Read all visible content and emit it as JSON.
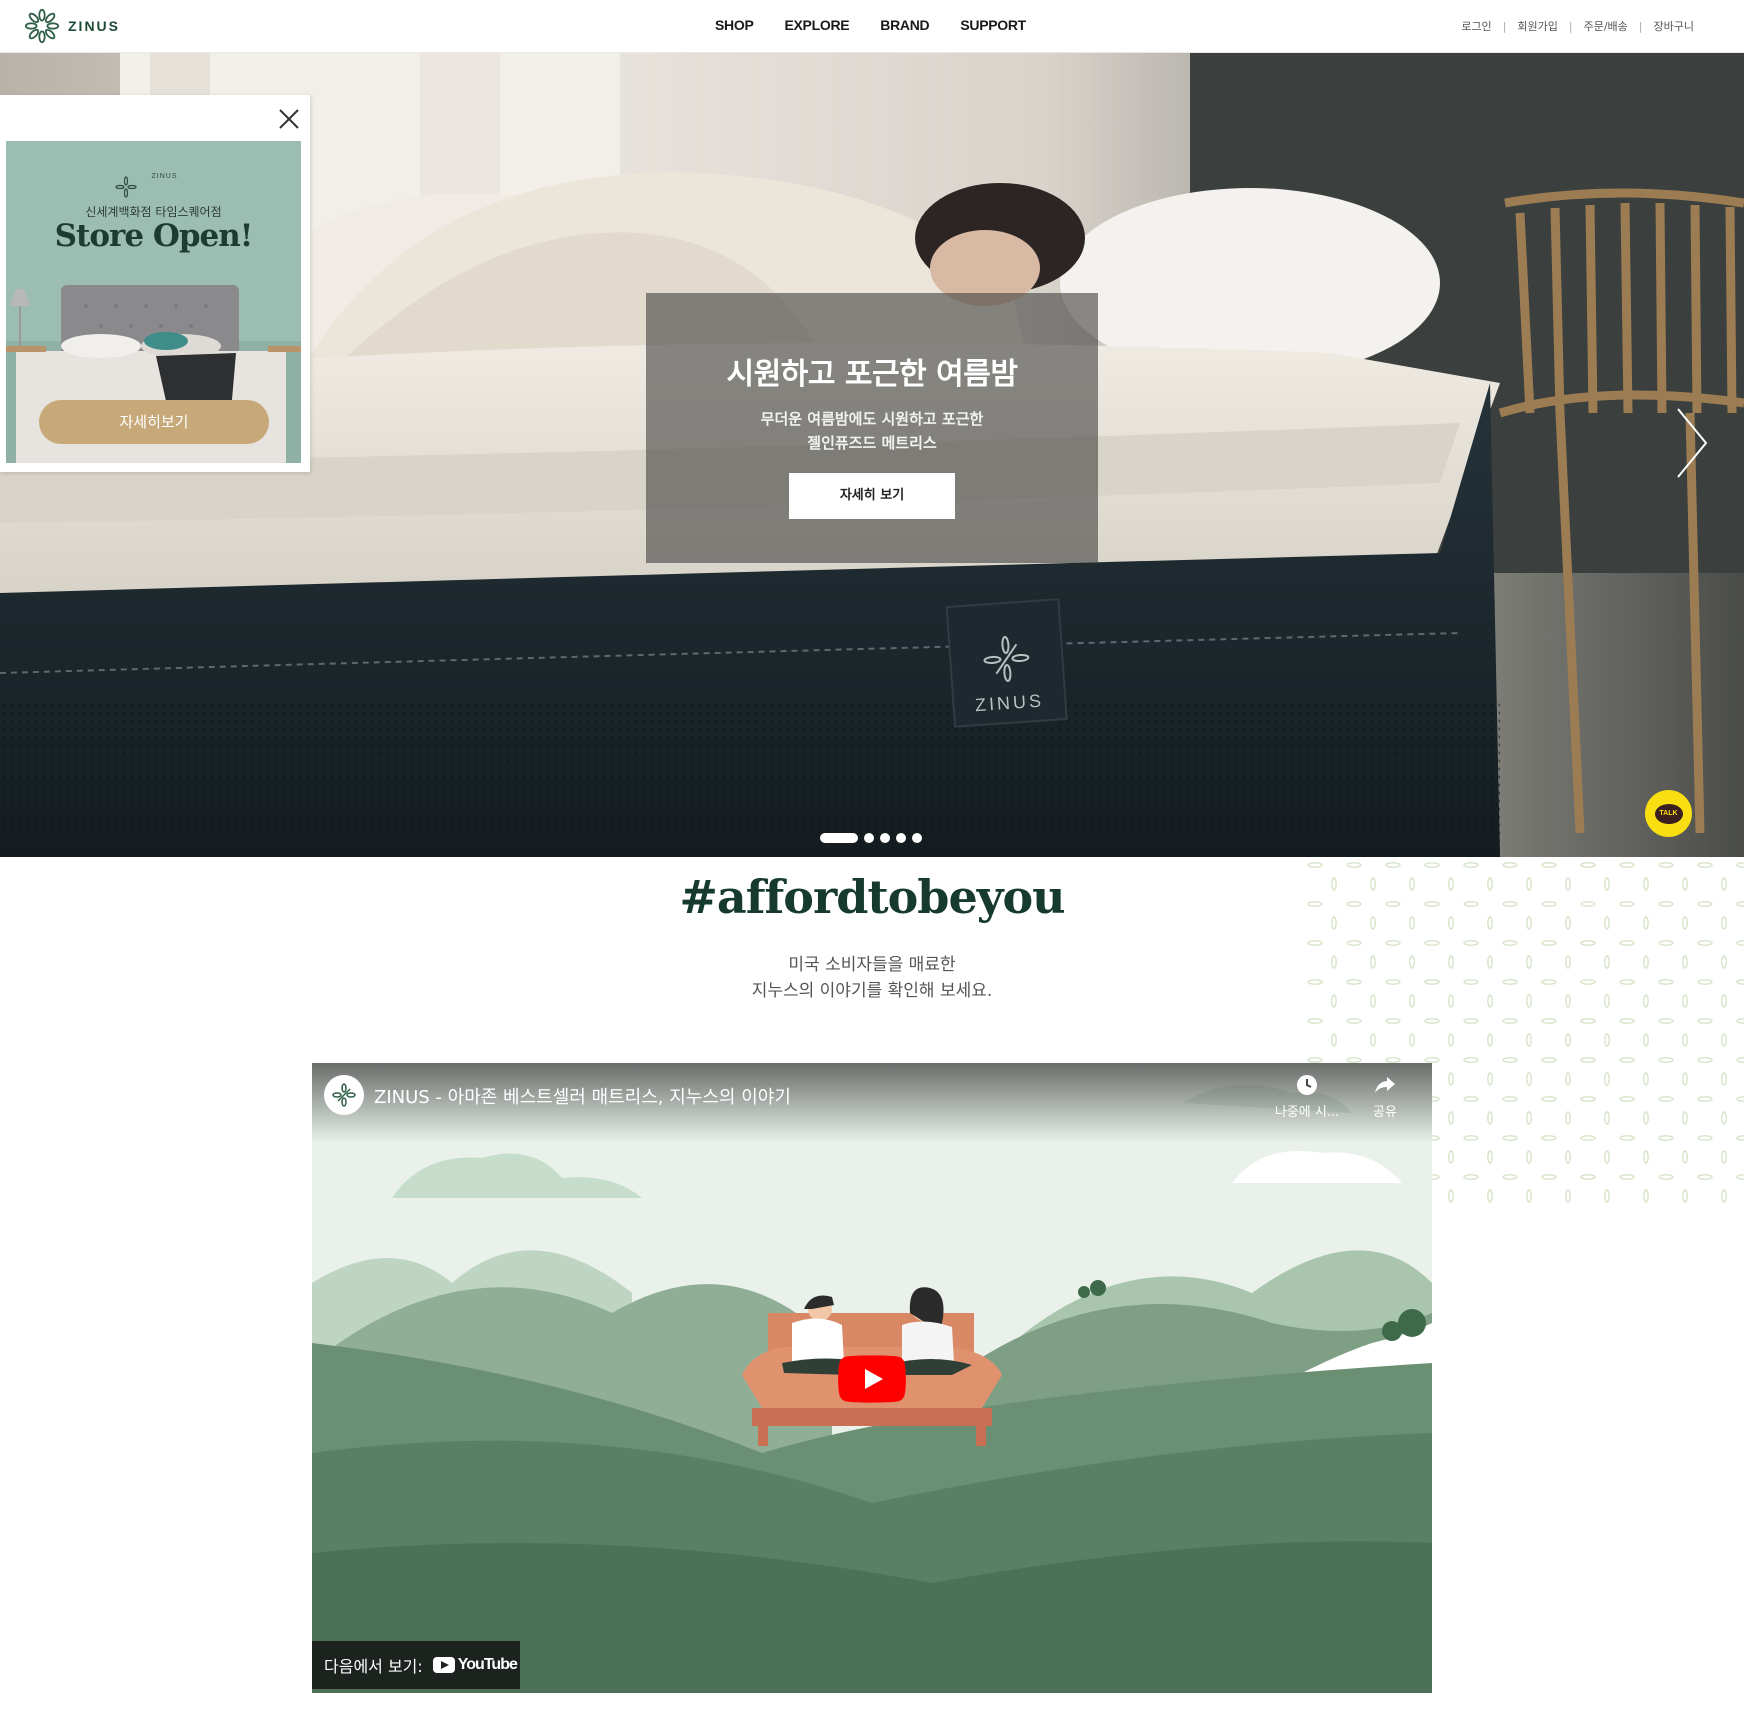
{
  "header": {
    "logo_text": "ZINUS",
    "nav": [
      {
        "label": "SHOP"
      },
      {
        "label": "EXPLORE"
      },
      {
        "label": "BRAND"
      },
      {
        "label": "SUPPORT"
      }
    ],
    "util": [
      {
        "label": "로그인"
      },
      {
        "label": "회원가입"
      },
      {
        "label": "주문/배송"
      },
      {
        "label": "장바구니"
      }
    ],
    "separator": "|"
  },
  "hero": {
    "title": "시원하고 포근한 여름밤",
    "desc_line1": "무더운 여름밤에도 시원하고 포근한",
    "desc_line2": "젤인퓨즈드 메트리스",
    "button_label": "자세히 보기",
    "mattress_label": "ZINUS",
    "active_slide": 1,
    "slide_count": 5
  },
  "popup": {
    "brand": "ZINUS",
    "subtitle": "신세계백화점 타임스퀘어점",
    "title": "Store Open!",
    "button_label": "자세히보기"
  },
  "talk": {
    "label": "TALK"
  },
  "section": {
    "hashtag": "#affordtobeyou",
    "desc_line1": "미국 소비자들을 매료한",
    "desc_line2": "지누스의 이야기를 확인해 보세요."
  },
  "video": {
    "title": "ZINUS - 아마존 베스트셀러 매트리스, 지누스의 이야기",
    "watch_later": "나중에 시...",
    "share": "공유",
    "watch_on": "다음에서 보기:",
    "youtube": "YouTube"
  },
  "colors": {
    "brand_green": "#1f4a35",
    "popup_button": "#c7a979",
    "kakao_yellow": "#f9df11",
    "youtube_red": "#ff0000"
  }
}
